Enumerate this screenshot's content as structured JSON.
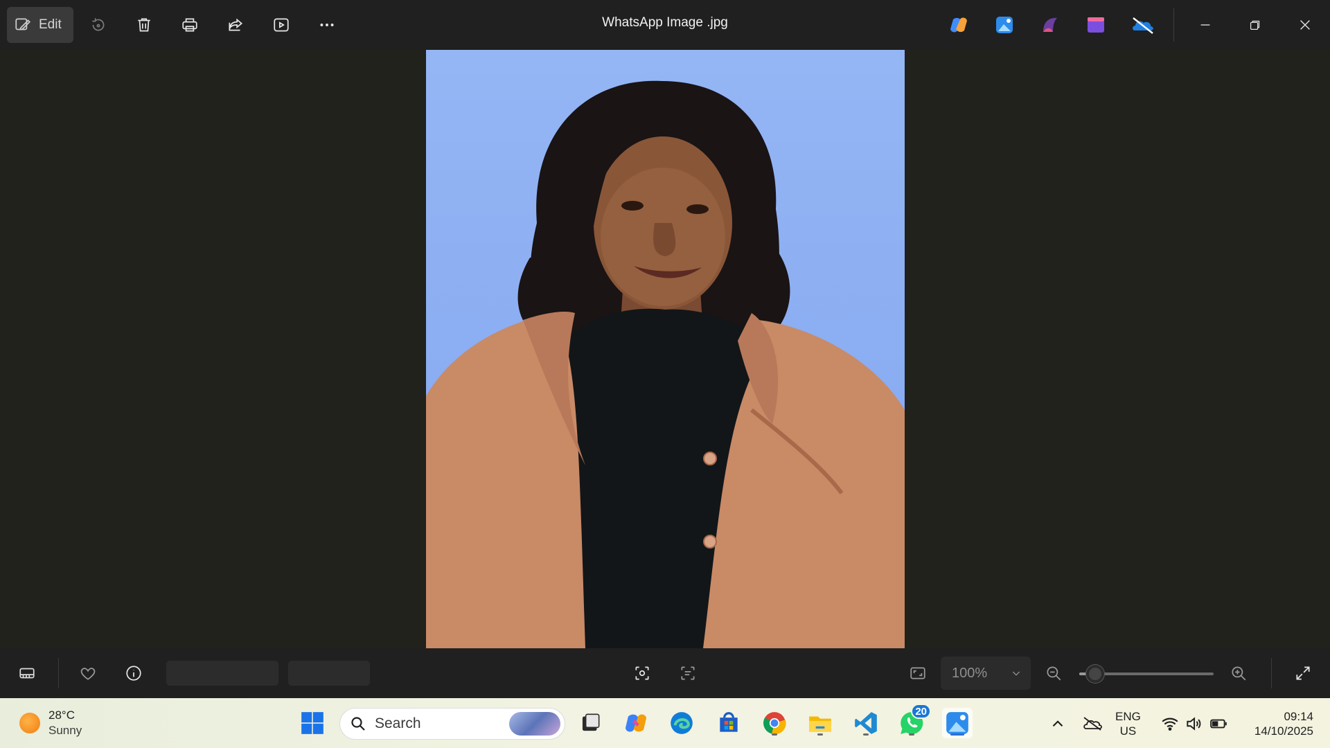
{
  "window": {
    "title": "WhatsApp Image .jpg"
  },
  "toolbar": {
    "edit_label": "Edit"
  },
  "bottombar": {
    "zoom_level": "100%",
    "zoom_slider_fraction": 0.12
  },
  "taskbar": {
    "weather": {
      "temperature": "28°C",
      "condition": "Sunny"
    },
    "search": {
      "placeholder": "Search"
    },
    "whatsapp_badge": "20",
    "language": {
      "line1": "ENG",
      "line2": "US"
    },
    "clock": {
      "time": "09:14",
      "date": "14/10/2025"
    }
  },
  "colors": {
    "photo_background": "#8fb0f3",
    "jacket": "#c98a66",
    "taskbar_accent": "#2c6fd6"
  },
  "icons": {
    "toolbar": [
      "edit-icon",
      "rotate-icon",
      "delete-icon",
      "print-icon",
      "share-icon",
      "slideshow-icon",
      "more-icon"
    ],
    "apps": [
      "copilot-icon",
      "photos-icon",
      "clipchamp-icon",
      "video-editor-icon",
      "onedrive-icon"
    ],
    "bottom": [
      "filmstrip-icon",
      "favorite-icon",
      "info-icon",
      "visual-search-icon",
      "text-scan-icon",
      "fit-to-window-icon",
      "zoom-out-icon",
      "zoom-in-icon",
      "fullscreen-icon"
    ],
    "taskbar": [
      "start-icon",
      "search-icon",
      "task-view-icon",
      "copilot-icon",
      "edge-icon",
      "store-icon",
      "chrome-icon",
      "file-explorer-icon",
      "vscode-icon",
      "whatsapp-icon",
      "photos-icon"
    ],
    "tray": [
      "chevron-up-icon",
      "onedrive-tray-icon",
      "wifi-icon",
      "volume-icon",
      "battery-icon"
    ]
  }
}
